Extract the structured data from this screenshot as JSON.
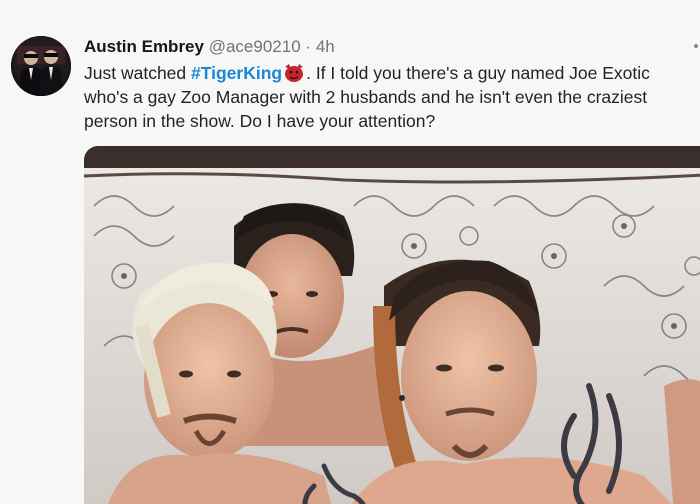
{
  "tweet": {
    "author_name": "Austin Embrey",
    "handle": "@ace90210",
    "separator": "·",
    "time": "4h",
    "text_prefix": "Just watched ",
    "hashtag": "#TigerKing",
    "line1_rest": ". If I told you there's a guy named Joe Exotic",
    "line2": "who's a gay Zoo Manager with 2 husbands and he isn't even the craziest",
    "line3": "person in the show. Do I have your attention?",
    "emoji_name": "tiger-emoji"
  },
  "media": {
    "description_icon": "photo-image",
    "accent_colors": {
      "hashtag": "#1b86d8",
      "handle": "#6b7580",
      "text": "#1f2226"
    }
  }
}
